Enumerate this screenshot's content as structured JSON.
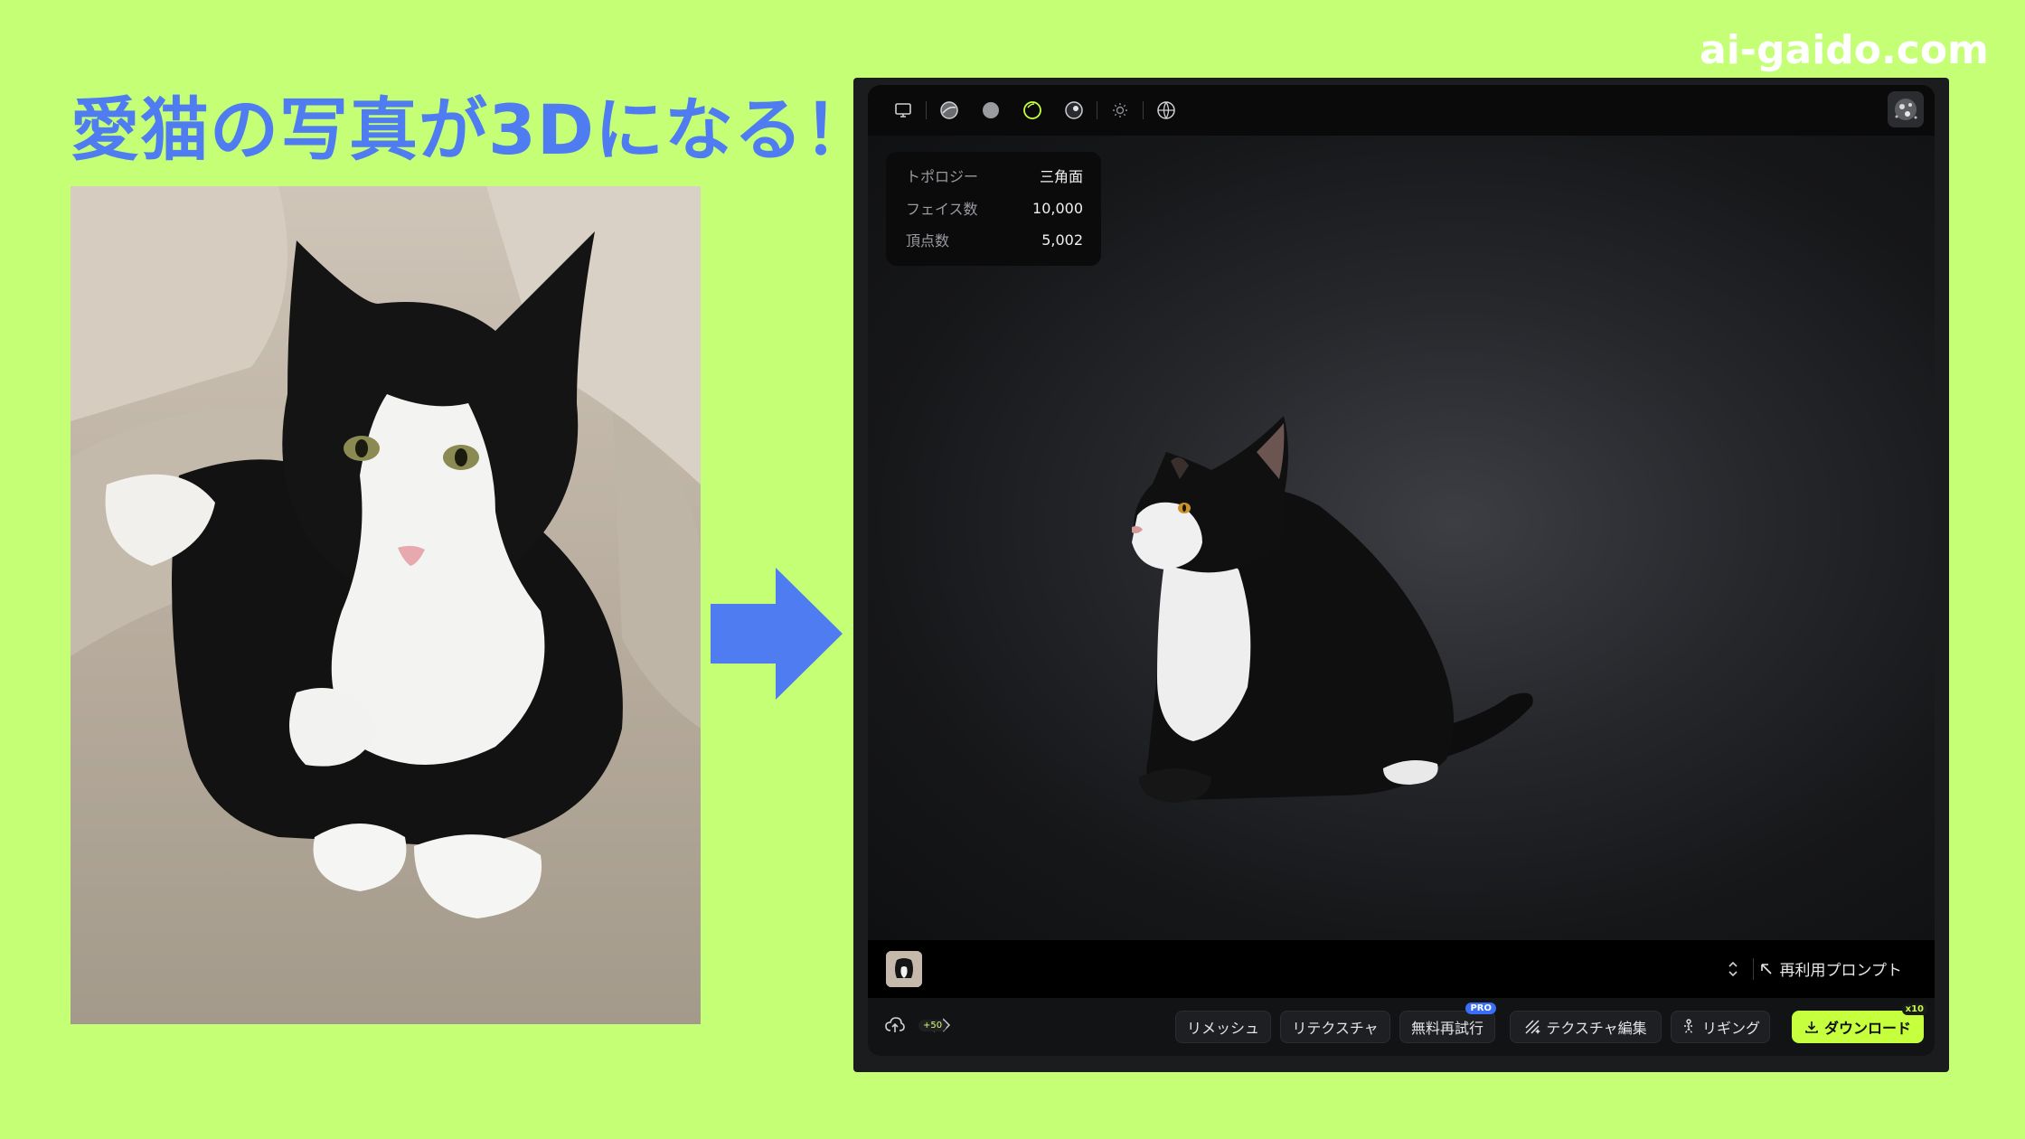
{
  "headline": "愛猫の写真が3Dになる！",
  "site": "ai-gaido.com",
  "stats": {
    "topology_label": "トポロジー",
    "topology_value": "三角面",
    "faces_label": "フェイス数",
    "faces_value": "10,000",
    "vertices_label": "頂点数",
    "vertices_value": "5,002"
  },
  "prompt_bar": {
    "reuse_label": "再利用プロンプト"
  },
  "bottom_bar": {
    "credits_badge": "+50",
    "remesh": "リメッシュ",
    "retexture": "リテクスチャ",
    "free_retry": "無料再試行",
    "pro_badge": "PRO",
    "texture_edit": "テクスチャ編集",
    "rigging": "リギング",
    "download": "ダウンロード",
    "download_badge": "x10"
  },
  "colors": {
    "background": "#c4ff75",
    "headline": "#4f7cf0",
    "accent": "#c6ff3d",
    "arrow": "#4f7cf0"
  },
  "icons": [
    "monitor-icon",
    "texture-sphere-icon",
    "solid-sphere-icon",
    "wireframe-sphere-icon",
    "material-sphere-icon",
    "light-icon",
    "globe-icon",
    "expand-collapse-icon",
    "arrow-up-left-icon",
    "upload-icon",
    "share-icon",
    "texture-edit-icon",
    "rigging-icon",
    "download-icon"
  ]
}
